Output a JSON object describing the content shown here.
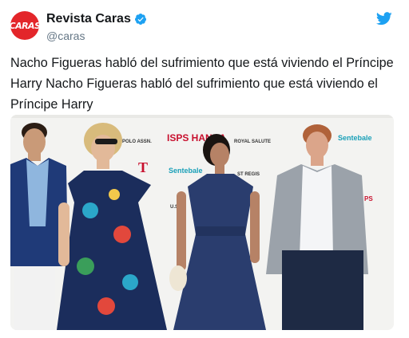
{
  "author": {
    "name": "Revista Caras",
    "handle": "@caras",
    "avatar_text": "CARAS",
    "verified": true
  },
  "tweet": {
    "text": "Nacho Figueras habló del sufrimiento que está viviendo el Príncipe Harry Nacho Figueras habló del sufrimiento que está viviendo el Príncipe Harry"
  },
  "photo": {
    "backdrop_logos": [
      "Sentebale",
      "ISPS HANDA",
      "POLO ASSN.",
      "ROYAL SALUTE",
      "ST REGIS",
      "U.S.",
      "T"
    ]
  },
  "colors": {
    "brand": "#1da1f2",
    "avatar_bg": "#e3262a",
    "text": "#14171a",
    "muted": "#657786"
  },
  "icons": {
    "verified": "verified-badge-icon",
    "platform": "twitter-bird-icon"
  }
}
